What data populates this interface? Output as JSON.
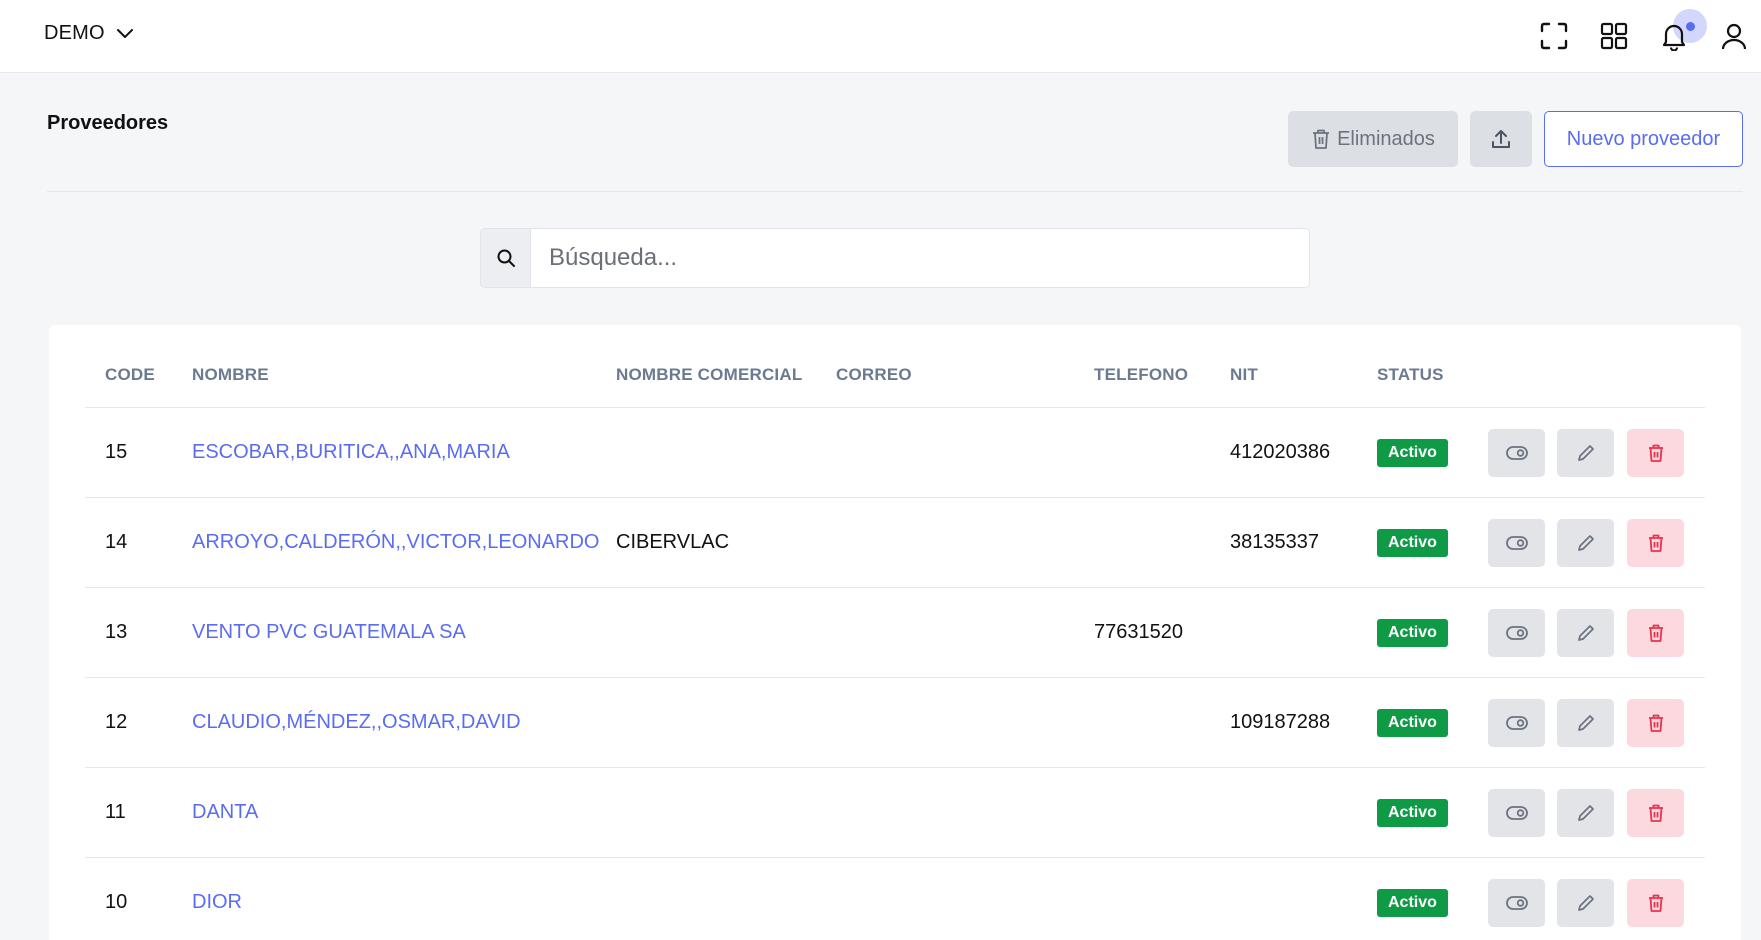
{
  "header": {
    "workspace": "DEMO"
  },
  "toolbar": {
    "title": "Proveedores",
    "deleted_label": "Eliminados",
    "new_label": "Nuevo proveedor"
  },
  "search": {
    "placeholder": "Búsqueda...",
    "value": ""
  },
  "table": {
    "columns": [
      "CODE",
      "NOMBRE",
      "NOMBRE COMERCIAL",
      "CORREO",
      "TELEFONO",
      "NIT",
      "STATUS"
    ],
    "rows": [
      {
        "code": "15",
        "nombre": "ESCOBAR,BURITICA,,ANA,MARIA",
        "comercial": "",
        "correo": "",
        "telefono": "",
        "nit": "412020386",
        "status": "Activo"
      },
      {
        "code": "14",
        "nombre": "ARROYO,CALDERÓN,,VICTOR,LEONARDO",
        "comercial": "CIBERVLAC",
        "correo": "",
        "telefono": "",
        "nit": "38135337",
        "status": "Activo"
      },
      {
        "code": "13",
        "nombre": "VENTO PVC GUATEMALA SA",
        "comercial": "",
        "correo": "",
        "telefono": "77631520",
        "nit": "",
        "status": "Activo"
      },
      {
        "code": "12",
        "nombre": "CLAUDIO,MÉNDEZ,,OSMAR,DAVID",
        "comercial": "",
        "correo": "",
        "telefono": "",
        "nit": "109187288",
        "status": "Activo"
      },
      {
        "code": "11",
        "nombre": "DANTA",
        "comercial": "",
        "correo": "",
        "telefono": "",
        "nit": "",
        "status": "Activo"
      },
      {
        "code": "10",
        "nombre": "DIOR",
        "comercial": "",
        "correo": "",
        "telefono": "",
        "nit": "",
        "status": "Activo"
      }
    ]
  },
  "icons": {
    "workspace_dropdown": "chevron-down-icon",
    "fullscreen": "fullscreen-icon",
    "apps": "apps-grid-icon",
    "notifications": "bell-icon",
    "user": "user-icon",
    "deleted": "trash-icon",
    "upload": "upload-icon",
    "search": "search-icon",
    "row_toggle": "toggle-icon",
    "row_edit": "pencil-icon",
    "row_delete": "trash-icon"
  },
  "colors": {
    "accent": "#5a6cf0",
    "status_active": "#0f9a46",
    "delete_bg": "#fcd9de",
    "delete_fg": "#e8344f"
  }
}
